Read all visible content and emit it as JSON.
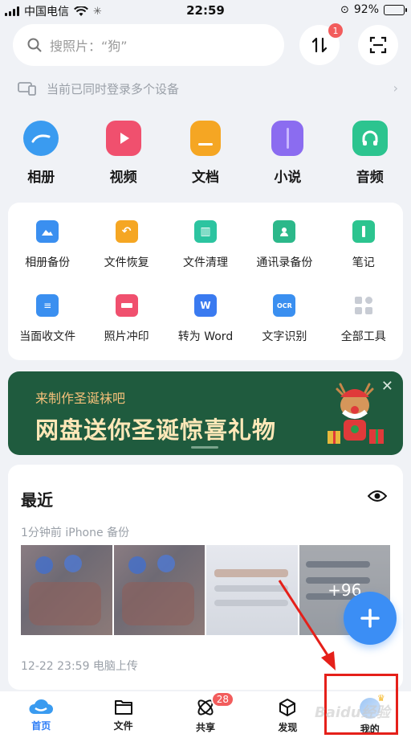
{
  "status_bar": {
    "carrier": "中国电信",
    "time": "22:59",
    "battery": "92%",
    "battery_level": 0.92
  },
  "search": {
    "placeholder": "搜照片：“狗”",
    "transfer_badge": "1"
  },
  "device_tip": {
    "text": "当前已同时登录多个设备"
  },
  "categories": [
    {
      "label": "相册",
      "icon": "cloud-album-icon",
      "color": "#3a9bf0"
    },
    {
      "label": "视频",
      "icon": "video-icon",
      "color": "#f0506e"
    },
    {
      "label": "文档",
      "icon": "document-icon",
      "color": "#f5a623"
    },
    {
      "label": "小说",
      "icon": "book-icon",
      "color": "#8b6cf0"
    },
    {
      "label": "音频",
      "icon": "headphones-icon",
      "color": "#2cc48f"
    }
  ],
  "tools": [
    {
      "label": "相册备份",
      "icon": "album-backup-icon",
      "color": "#3a8ff0"
    },
    {
      "label": "文件恢复",
      "icon": "file-restore-icon",
      "color": "#f5a623"
    },
    {
      "label": "文件清理",
      "icon": "file-clean-icon",
      "color": "#2cc4a0"
    },
    {
      "label": "通讯录备份",
      "icon": "contacts-backup-icon",
      "color": "#2cb88a"
    },
    {
      "label": "笔记",
      "icon": "note-icon",
      "color": "#2cc48f"
    },
    {
      "label": "当面收文件",
      "icon": "receive-file-icon",
      "color": "#3a8ff0"
    },
    {
      "label": "照片冲印",
      "icon": "photo-print-icon",
      "color": "#f0506e"
    },
    {
      "label": "转为 Word",
      "icon": "word-icon",
      "color": "#3a7af0"
    },
    {
      "label": "文字识别",
      "icon": "ocr-icon",
      "color": "#3a8ff0"
    },
    {
      "label": "全部工具",
      "icon": "all-tools-icon",
      "color": "#c8ccd4"
    }
  ],
  "banner": {
    "subtitle": "来制作圣诞袜吧",
    "title": "网盘送你圣诞惊喜礼物"
  },
  "recent": {
    "title": "最近",
    "backup_meta": "1分钟前 iPhone 备份",
    "more_count": "+96",
    "upload_meta": "12-22 23:59 电脑上传"
  },
  "tabs": [
    {
      "label": "首页",
      "icon": "home-cloud-icon",
      "active": true
    },
    {
      "label": "文件",
      "icon": "folder-icon"
    },
    {
      "label": "共享",
      "icon": "share-atom-icon",
      "badge": "28"
    },
    {
      "label": "发现",
      "icon": "discover-cube-icon"
    },
    {
      "label": "我的",
      "icon": "avatar-icon"
    }
  ],
  "watermark": "Baidu经验"
}
